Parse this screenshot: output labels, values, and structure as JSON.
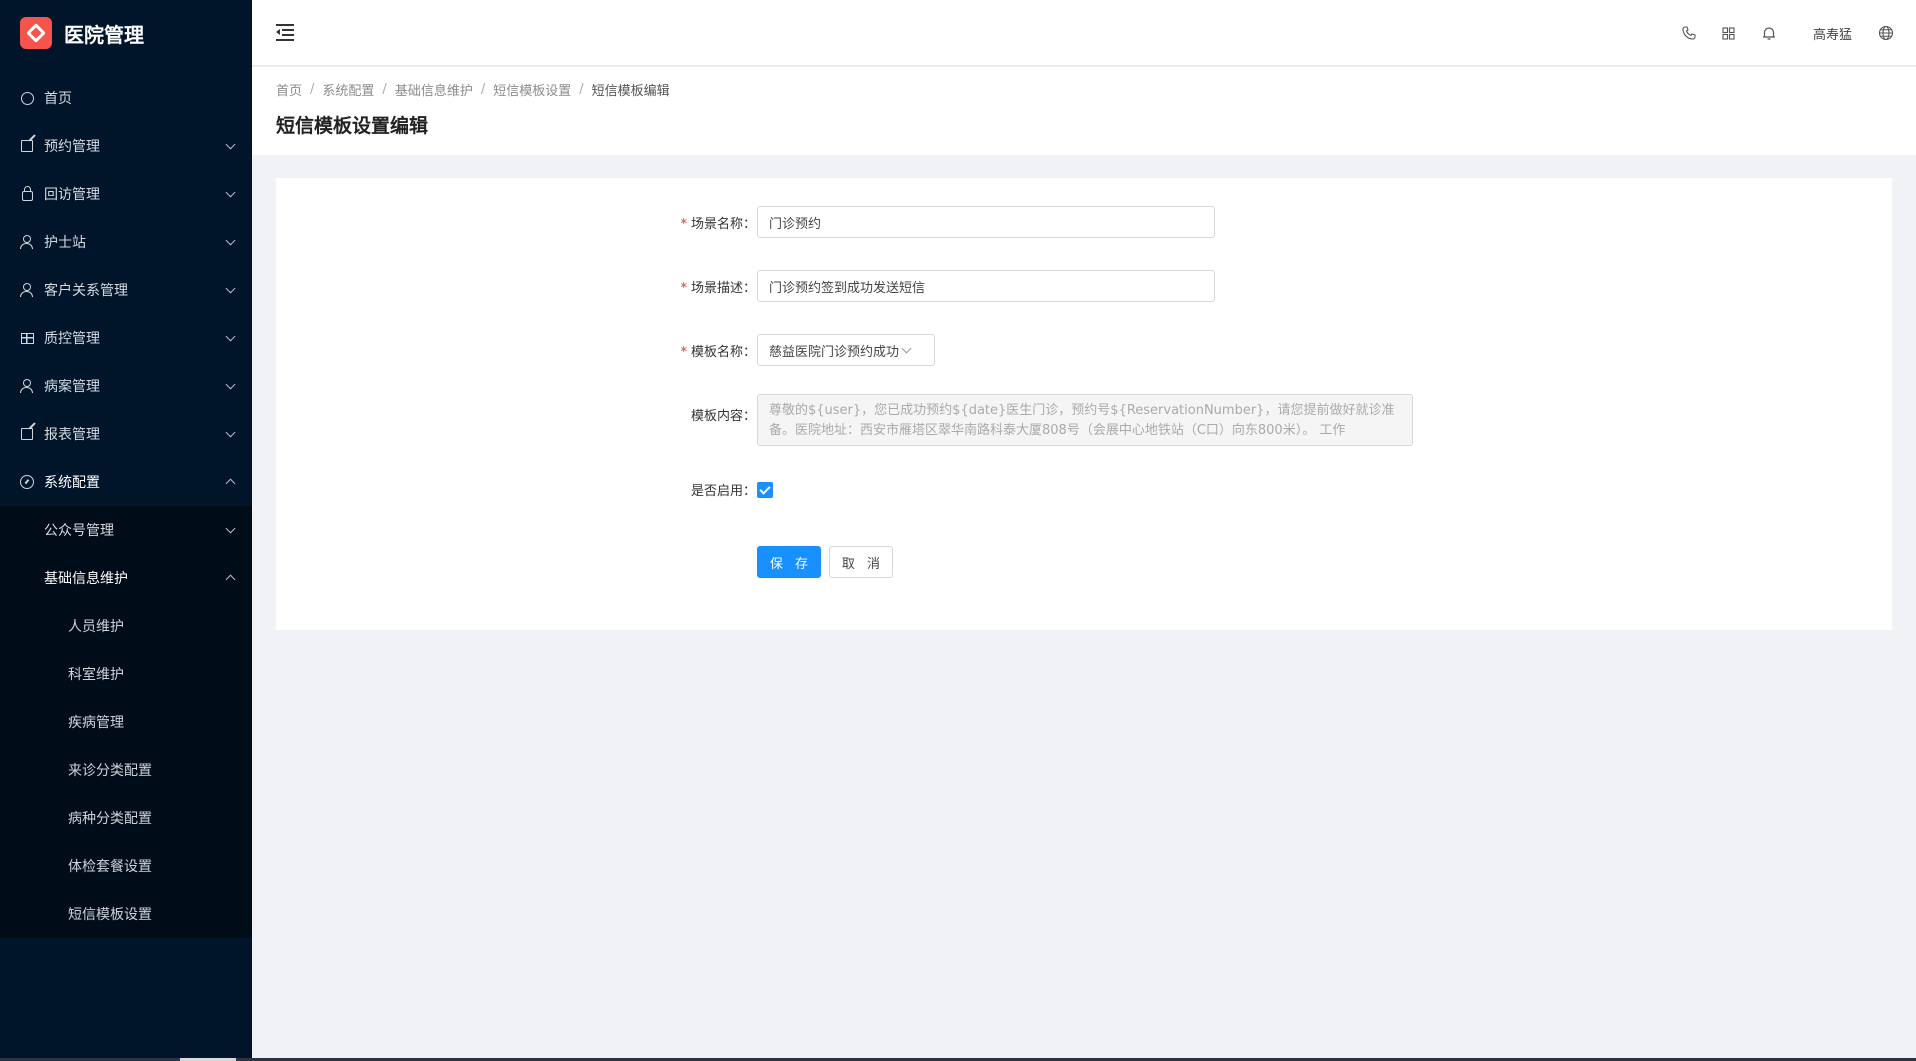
{
  "app": {
    "title": "医院管理"
  },
  "sidebar": {
    "items": [
      {
        "label": "首页",
        "icon": "home-icon"
      },
      {
        "label": "预约管理",
        "icon": "edit-icon"
      },
      {
        "label": "回访管理",
        "icon": "lock-icon"
      },
      {
        "label": "护士站",
        "icon": "user-icon"
      },
      {
        "label": "客户关系管理",
        "icon": "user-icon"
      },
      {
        "label": "质控管理",
        "icon": "table-icon"
      },
      {
        "label": "病案管理",
        "icon": "user-icon"
      },
      {
        "label": "报表管理",
        "icon": "edit-icon"
      },
      {
        "label": "系统配置",
        "icon": "dashboard-icon"
      }
    ],
    "system_sub": [
      {
        "label": "公众号管理"
      },
      {
        "label": "基础信息维护"
      }
    ],
    "basic_info_leaves": [
      {
        "label": "人员维护"
      },
      {
        "label": "科室维护"
      },
      {
        "label": "疾病管理"
      },
      {
        "label": "来诊分类配置"
      },
      {
        "label": "病种分类配置"
      },
      {
        "label": "体检套餐设置"
      },
      {
        "label": "短信模板设置"
      }
    ]
  },
  "header": {
    "username": "高寿猛",
    "icons": [
      "phone-icon",
      "grid-icon",
      "bell-icon",
      "globe-icon"
    ]
  },
  "breadcrumb": [
    "首页",
    "系统配置",
    "基础信息维护",
    "短信模板设置",
    "短信模板编辑"
  ],
  "page_title": "短信模板设置编辑",
  "form": {
    "scene_name": {
      "label": "场景名称",
      "value": "门诊预约"
    },
    "scene_desc": {
      "label": "场景描述",
      "value": "门诊预约签到成功发送短信"
    },
    "template_name": {
      "label": "模板名称",
      "value": "慈益医院门诊预约成功"
    },
    "template_content": {
      "label": "模板内容",
      "line1": "尊敬的${user}，您已成功预约${date}医生门诊，预约号${ReservationNumber}，请您提前做好就诊准",
      "line2": "备。医院地址：西安市雁塔区翠华南路科泰大厦808号（会展中心地铁站（C口）向东800米）。 工作"
    },
    "enabled": {
      "label": "是否启用",
      "checked": true
    },
    "save_label": "保 存",
    "cancel_label": "取 消"
  },
  "colors": {
    "sidebar_bg": "#001529",
    "primary": "#1890ff",
    "logo": "#f5534b",
    "required": "#f5222d"
  }
}
